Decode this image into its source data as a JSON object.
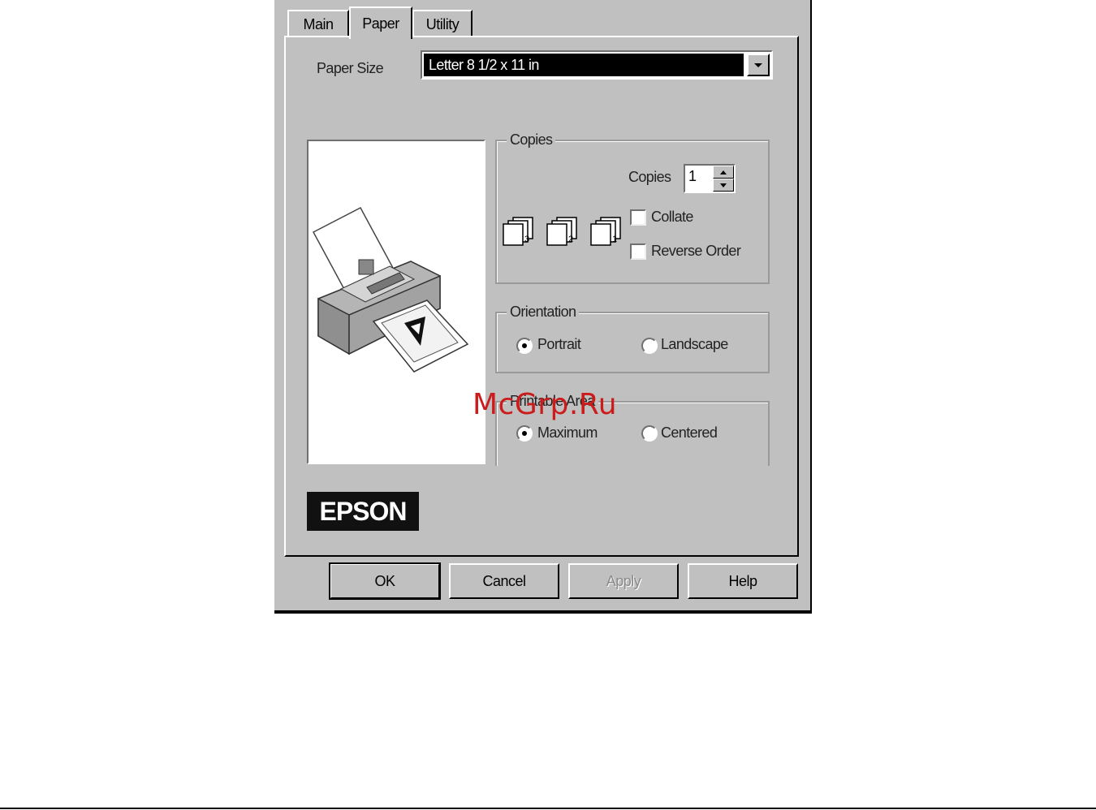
{
  "tabs": [
    {
      "label": "Main",
      "active": false
    },
    {
      "label": "Paper",
      "active": true
    },
    {
      "label": "Utility",
      "active": false
    }
  ],
  "paper_size": {
    "label": "Paper Size",
    "value": "Letter 8 1/2 x 11 in"
  },
  "copies_group": {
    "title": "Copies",
    "copies_label": "Copies",
    "copies_value": "1",
    "collate_label": "Collate",
    "collate_checked": false,
    "reverse_label": "Reverse Order",
    "reverse_checked": false,
    "collate_icons": [
      "3",
      "2",
      "1"
    ]
  },
  "orientation_group": {
    "title": "Orientation",
    "portrait_label": "Portrait",
    "landscape_label": "Landscape",
    "selected": "Portrait"
  },
  "printable_group": {
    "title": "Printable Area",
    "maximum_label": "Maximum",
    "centered_label": "Centered",
    "selected": "Maximum"
  },
  "logo": "EPSON",
  "buttons": {
    "ok": "OK",
    "cancel": "Cancel",
    "apply": "Apply",
    "help": "Help"
  },
  "watermark": "McGrp.Ru",
  "colors": {
    "dialog_bg": "#c0c0c0",
    "selection": "#000000",
    "watermark": "#cc1b1b"
  }
}
